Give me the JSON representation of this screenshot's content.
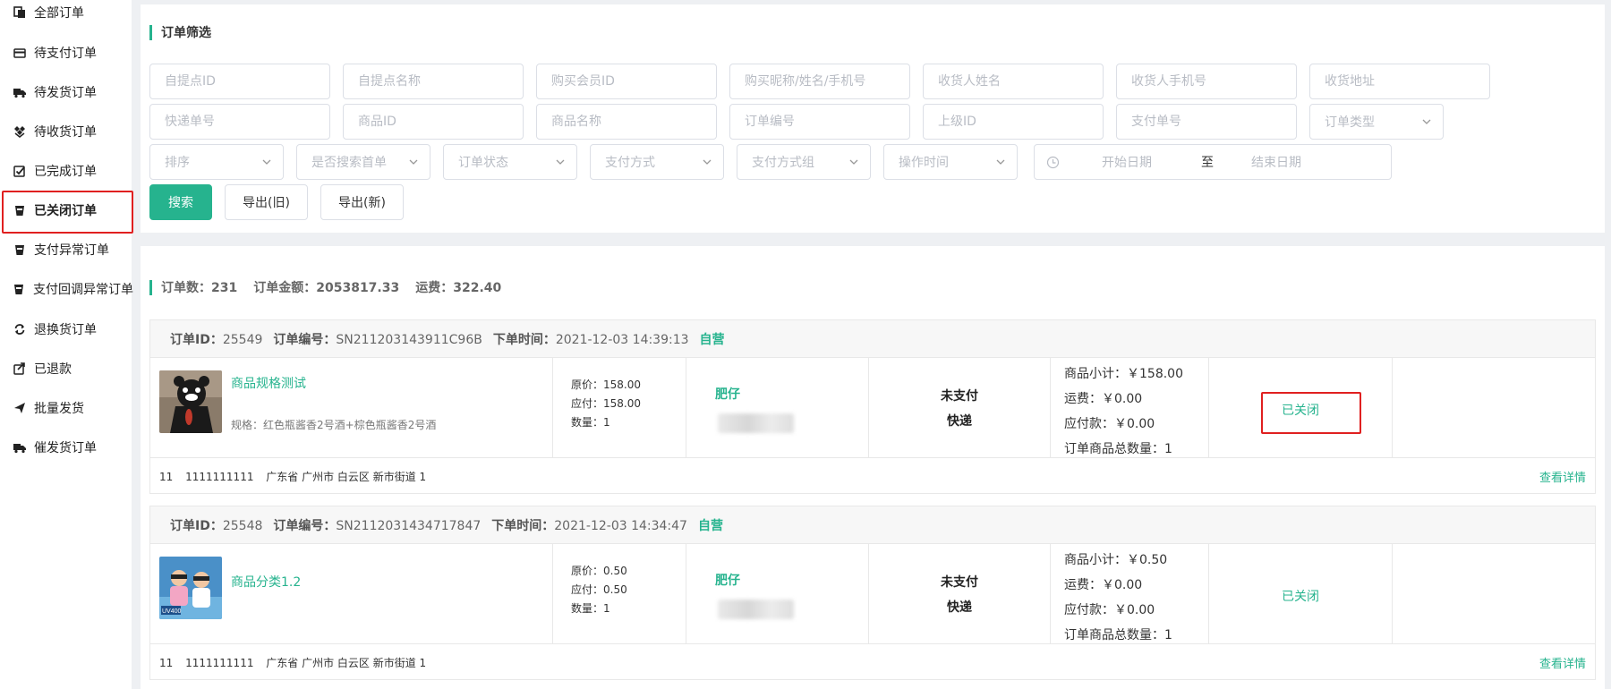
{
  "sidebar": {
    "items": [
      {
        "label": "全部订单",
        "icon": "orders-icon"
      },
      {
        "label": "待支付订单",
        "icon": "card-icon"
      },
      {
        "label": "待发货订单",
        "icon": "truck-icon"
      },
      {
        "label": "待收货订单",
        "icon": "box-icon"
      },
      {
        "label": "已完成订单",
        "icon": "check-square-icon"
      },
      {
        "label": "已关闭订单",
        "icon": "cup-icon"
      },
      {
        "label": "支付异常订单",
        "icon": "cup-icon"
      },
      {
        "label": "支付回调异常订单",
        "icon": "cup-icon"
      },
      {
        "label": "退换货订单",
        "icon": "refresh-icon"
      },
      {
        "label": "已退款",
        "icon": "share-icon"
      },
      {
        "label": "批量发货",
        "icon": "send-icon"
      },
      {
        "label": "催发货订单",
        "icon": "truck-icon"
      }
    ],
    "active_label": "已关闭订单"
  },
  "filter": {
    "title": "订单筛选",
    "fields_row1": [
      "自提点ID",
      "自提点名称",
      "购买会员ID",
      "购买昵称/姓名/手机号",
      "收货人姓名",
      "收货人手机号",
      "收货地址"
    ],
    "fields_row2": [
      "快递单号",
      "商品ID",
      "商品名称",
      "订单编号",
      "上级ID",
      "支付单号"
    ],
    "order_type": "订单类型",
    "selects_row3": [
      "排序",
      "是否搜索首单",
      "订单状态",
      "支付方式",
      "支付方式组",
      "操作时间"
    ],
    "date_start": "开始日期",
    "date_sep": "至",
    "date_end": "结束日期",
    "search_label": "搜索",
    "export_old_label": "导出(旧)",
    "export_new_label": "导出(新)"
  },
  "summary": {
    "count": "订单数：231",
    "amount": "订单金额：2053817.33",
    "freight": "运费：322.40"
  },
  "orders": [
    {
      "id_label": "订单ID：",
      "id": "25549",
      "no_label": "订单编号：",
      "no": "SN211203143911C96B",
      "time_label": "下单时间：",
      "time": "2021-12-03 14:39:13",
      "tag": "自营",
      "product_name": "商品规格测试",
      "spec": "规格：红色瓶酱香2号酒+棕色瓶酱香2号酒",
      "orig_price": "原价：158.00",
      "pay_price": "应付：158.00",
      "qty": "数量：1",
      "buyer": "肥仔",
      "pay_status": "未支付",
      "ship": "快递",
      "subtotal": "商品小计：￥158.00",
      "freight": "运费：￥0.00",
      "payable": "应付款：￥0.00",
      "total_qty": "订单商品总数量：1",
      "status": "已关闭",
      "foot_a": "11",
      "foot_b": "1111111111",
      "foot_c": "广东省 广州市 白云区 新市街道 1",
      "detail": "查看详情"
    },
    {
      "id_label": "订单ID：",
      "id": "25548",
      "no_label": "订单编号：",
      "no": "SN2112031434717847",
      "time_label": "下单时间：",
      "time": "2021-12-03 14:34:47",
      "tag": "自营",
      "product_name": "商品分类1.2",
      "thumb_text": "UV400",
      "orig_price": "原价：0.50",
      "pay_price": "应付：0.50",
      "qty": "数量：1",
      "buyer": "肥仔",
      "pay_status": "未支付",
      "ship": "快递",
      "subtotal": "商品小计：￥0.50",
      "freight": "运费：￥0.00",
      "payable": "应付款：￥0.00",
      "total_qty": "订单商品总数量：1",
      "status": "已关闭",
      "foot_a": "11",
      "foot_b": "1111111111",
      "foot_c": "广东省 广州市 白云区 新市街道 1",
      "detail": "查看详情"
    }
  ],
  "colors": {
    "accent": "#26b38e",
    "highlight": "#e02020"
  }
}
